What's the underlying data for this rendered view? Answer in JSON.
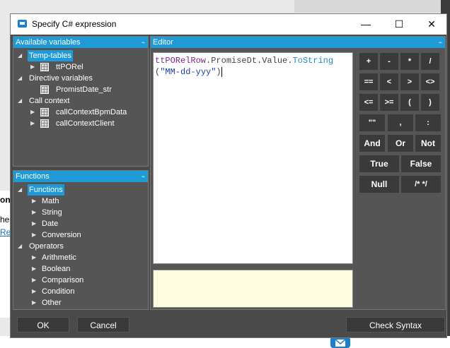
{
  "background": {
    "left_heading": "on",
    "left_text": "he",
    "left_link": "Rel"
  },
  "dialog": {
    "title": "Specify C# expression",
    "window_buttons": {
      "minimize": "—",
      "maximize": "☐",
      "close": "✕"
    }
  },
  "variables_panel": {
    "title": "Available variables",
    "items": [
      {
        "label": "Temp-tables",
        "selected": true
      },
      {
        "label": "ttPORel"
      },
      {
        "label": "Directive variables"
      },
      {
        "label": "PromistDate_str"
      },
      {
        "label": "Call context"
      },
      {
        "label": "callContextBpmData"
      },
      {
        "label": "callContextClient"
      }
    ]
  },
  "functions_panel": {
    "title": "Functions",
    "items": [
      {
        "label": "Functions",
        "selected": true
      },
      {
        "label": "Math"
      },
      {
        "label": "String"
      },
      {
        "label": "Date"
      },
      {
        "label": "Conversion"
      },
      {
        "label": "Operators"
      },
      {
        "label": "Arithmetic"
      },
      {
        "label": "Boolean"
      },
      {
        "label": "Comparison"
      },
      {
        "label": "Condition"
      },
      {
        "label": "Other"
      }
    ]
  },
  "editor": {
    "title": "Editor",
    "code": {
      "obj": "ttPORelRow",
      "dot1": ".",
      "member1": "PromiseDt",
      "dot2": ".",
      "member2": "Value",
      "dot3": ".",
      "fn": "ToString",
      "open": "(",
      "str": "\"MM-dd-yyy\"",
      "close": ")"
    }
  },
  "keypad": {
    "row1": [
      "+",
      "-",
      "*",
      "/"
    ],
    "row2": [
      "==",
      "<",
      ">",
      "<>"
    ],
    "row3": [
      "<=",
      ">=",
      "(",
      ")"
    ],
    "row4": [
      "\"\"",
      ",",
      ":"
    ],
    "row5": [
      "And",
      "Or",
      "Not"
    ],
    "row6": [
      "True",
      "False"
    ],
    "row7": [
      "Null",
      "/* */"
    ]
  },
  "footer": {
    "ok": "OK",
    "cancel": "Cancel",
    "check_syntax": "Check Syntax"
  },
  "pin_glyph": "⌁"
}
